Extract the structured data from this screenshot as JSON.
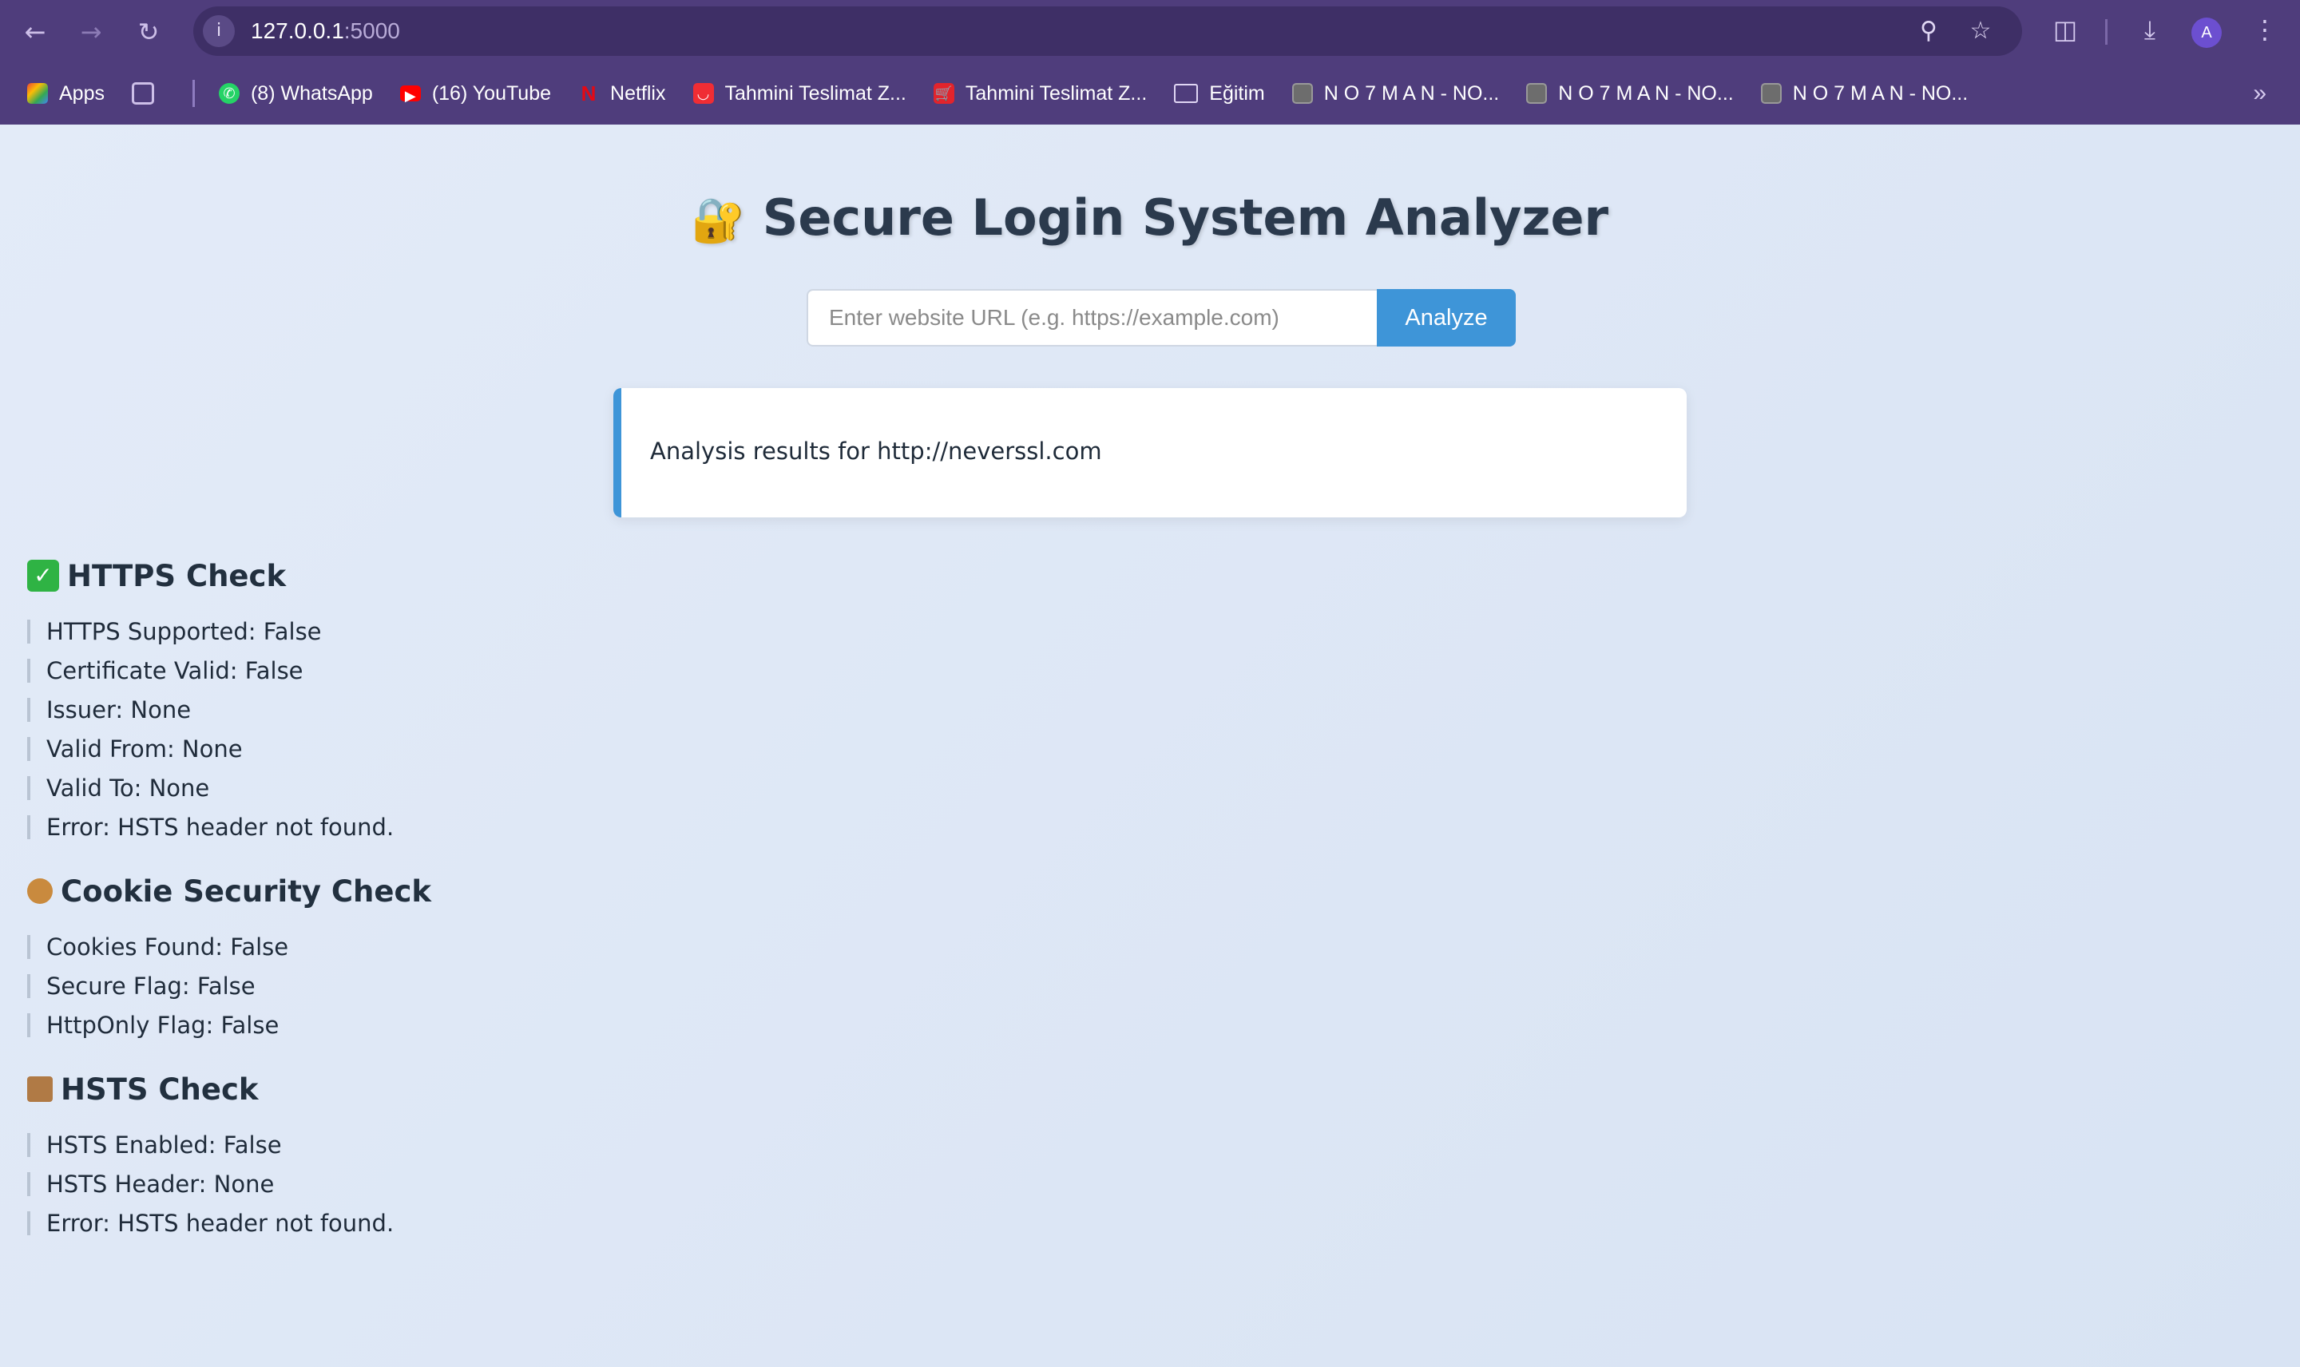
{
  "browser": {
    "url_host": "127.0.0.1",
    "url_port": ":5000",
    "profile_initial": "A",
    "bookmarks": [
      {
        "label": "Apps",
        "icon": "apps-grid-icon"
      },
      {
        "label": "(8) WhatsApp",
        "icon": "whatsapp-icon"
      },
      {
        "label": "(16) YouTube",
        "icon": "youtube-icon"
      },
      {
        "label": "Netflix",
        "icon": "netflix-icon"
      },
      {
        "label": "Tahmini Teslimat Z...",
        "icon": "store-icon"
      },
      {
        "label": "Tahmini Teslimat Z...",
        "icon": "cart-icon"
      },
      {
        "label": "Eğitim",
        "icon": "folder-icon"
      },
      {
        "label": "N O 7 M A N - NO...",
        "icon": "site-icon"
      },
      {
        "label": "N O 7 M A N - NO...",
        "icon": "site-icon"
      },
      {
        "label": "N O 7 M A N - NO...",
        "icon": "site-icon"
      }
    ]
  },
  "page": {
    "title": "Secure Login System Analyzer",
    "url_placeholder": "Enter website URL (e.g. https://example.com)",
    "analyze_label": "Analyze",
    "result_text": "Analysis results for http://neverssl.com"
  },
  "sections": {
    "https": {
      "title": "HTTPS Check",
      "items": [
        "HTTPS Supported: False",
        "Certificate Valid: False",
        "Issuer: None",
        "Valid From: None",
        "Valid To: None",
        "Error: HSTS header not found."
      ]
    },
    "cookie": {
      "title": "Cookie Security Check",
      "items": [
        "Cookies Found: False",
        "Secure Flag: False",
        "HttpOnly Flag: False"
      ]
    },
    "hsts": {
      "title": "HSTS Check",
      "items": [
        "HSTS Enabled: False",
        "HSTS Header: None",
        "Error: HSTS header not found."
      ]
    }
  },
  "colors": {
    "chrome": "#4f3d7c",
    "accent": "#3e95d8",
    "title_text": "#2b3a4d"
  }
}
